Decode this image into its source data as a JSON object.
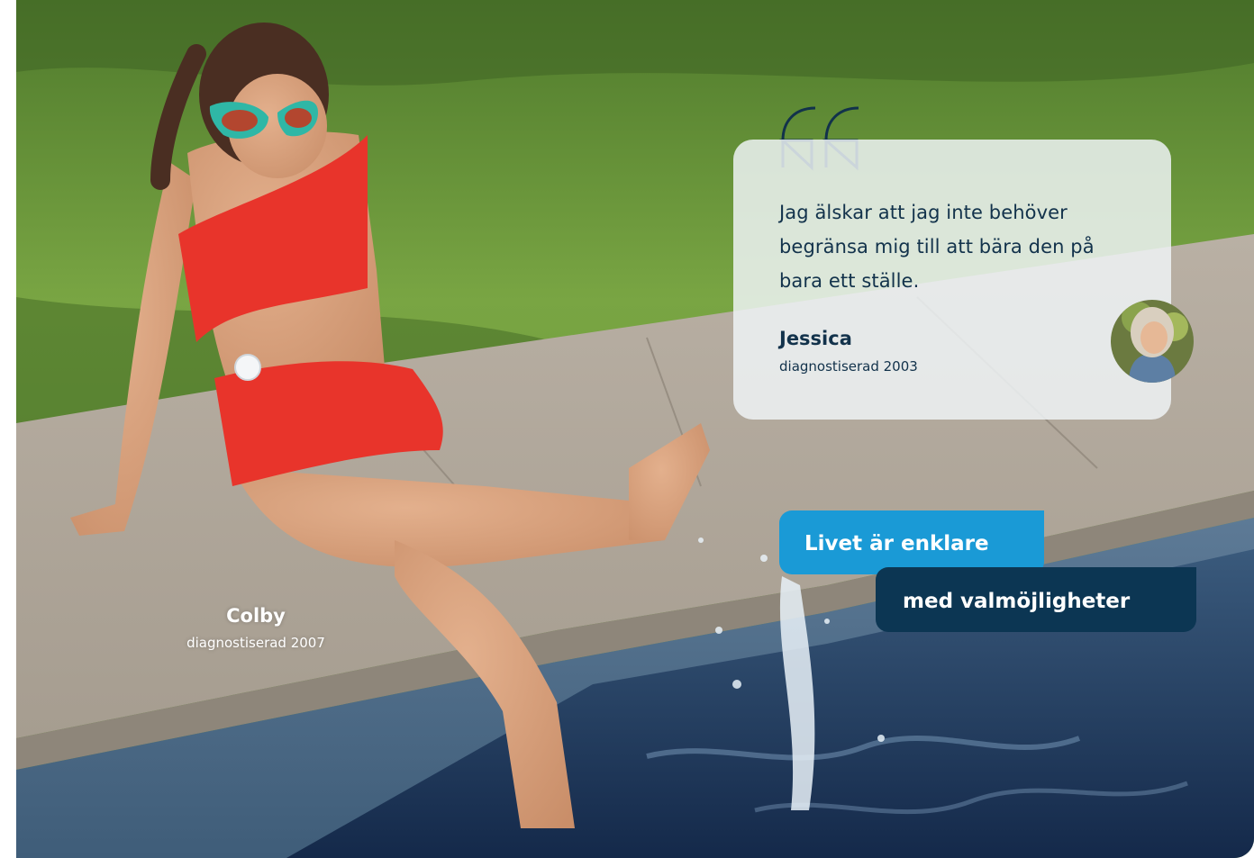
{
  "testimonial": {
    "quote": "Jag älskar att jag inte behöver begränsa mig till att bära den på bara ett ställe.",
    "name": "Jessica",
    "subtitle": "diagnostiserad 2003",
    "quote_icon": "quote-mark-icon",
    "avatar": "portrait-photo"
  },
  "person": {
    "name": "Colby",
    "subtitle": "diagnostiserad 2007"
  },
  "tagline": {
    "line1": "Livet är enklare",
    "line2": "med valmöjligheter"
  },
  "colors": {
    "accent_blue": "#1a9ad6",
    "navy": "#0c3653",
    "text_navy": "#12324b",
    "swimsuit_red": "#e8342b",
    "sunglasses_teal": "#2fb7a6"
  }
}
